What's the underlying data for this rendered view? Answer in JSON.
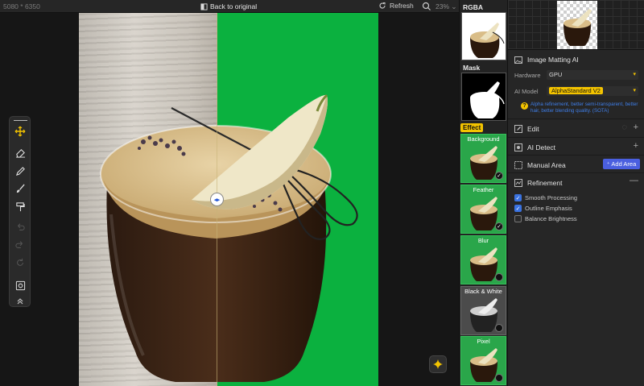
{
  "topbar": {
    "dimensions": "5080 * 6350",
    "back_label": "Back to original",
    "refresh_label": "Refresh",
    "zoom": "23%"
  },
  "effects": {
    "rgba_label": "RGBA",
    "mask_label": "Mask",
    "effect_tag": "Effect",
    "items": [
      {
        "label": "Background",
        "selected": true
      },
      {
        "label": "Feather",
        "selected": true
      },
      {
        "label": "Blur",
        "selected": false
      },
      {
        "label": "Black & White",
        "selected": false
      },
      {
        "label": "Pixel",
        "selected": false
      }
    ]
  },
  "panel": {
    "matting_title": "Image Matting AI",
    "hardware_label": "Hardware",
    "hardware_value": "GPU",
    "model_label": "AI Model",
    "model_value": "AlphaStandard  V2",
    "hint": "Alpha refinement, better semi-transparent, better hair, better blending quality. (SOTA)",
    "edit_label": "Edit",
    "detect_label": "AI Detect",
    "manual_label": "Manual Area",
    "add_area_label": "Add Area",
    "refinement_label": "Refinement",
    "options": [
      {
        "label": "Smooth Processing",
        "checked": true
      },
      {
        "label": "Outline Emphasis",
        "checked": true
      },
      {
        "label": "Balance Brightness",
        "checked": false
      }
    ]
  },
  "colors": {
    "accent_yellow": "#f4c400",
    "accent_blue": "#4a5fe0",
    "chroma_green": "#0bb13f"
  }
}
